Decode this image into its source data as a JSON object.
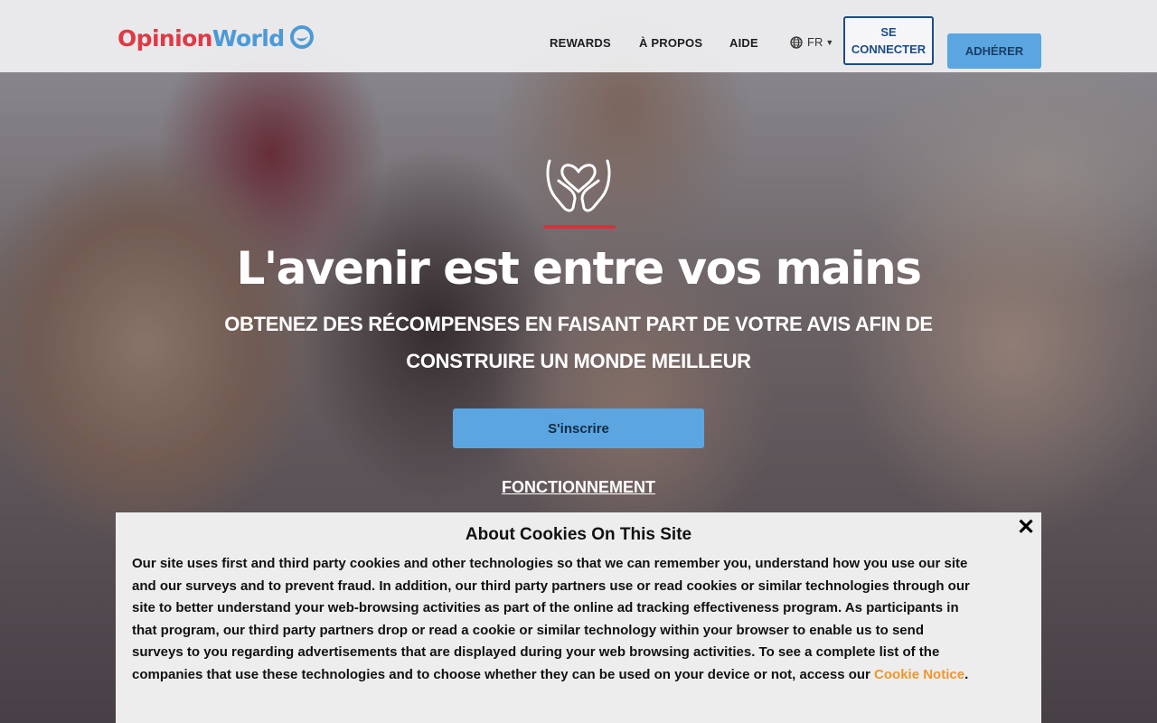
{
  "header": {
    "logo": {
      "part1": "Opinion",
      "part2": "World"
    },
    "nav": [
      {
        "label": "REWARDS"
      },
      {
        "label": "À PROPOS"
      },
      {
        "label": "AIDE"
      }
    ],
    "language": {
      "label": "FR",
      "icon": "globe-icon"
    },
    "login_label": "SE CONNECTER",
    "join_label": "ADHÉRER"
  },
  "hero": {
    "icon": "hands-heart-icon",
    "title": "L'avenir est entre vos mains",
    "subtitle": "OBTENEZ DES RÉCOMPENSES EN FAISANT PART DE VOTRE AVIS AFIN DE CONSTRUIRE UN MONDE MEILLEUR",
    "signup_label": "S'inscrire",
    "how_link": "FONCTIONNEMENT"
  },
  "cookie_banner": {
    "title": "About Cookies On This Site",
    "close_label": "✕",
    "text": "Our site uses first and third party cookies and other technologies so that we can remember you, understand how you use our site and our surveys and to prevent fraud. In addition, our third party partners use or read cookies or similar technologies through our site to better understand your web-browsing activities as part of the online ad tracking effectiveness program. As participants in that program, our third party partners drop or read a cookie or similar technology within your browser to enable us to send surveys to you regarding advertisements that are displayed during your web browsing activities. To see a complete list of the companies that use these technologies and to choose whether they can be used on your device or not, access our ",
    "link_label": "Cookie Notice",
    "text_end": "."
  },
  "colors": {
    "brand_red": "#e03a45",
    "brand_blue": "#4a9ad8",
    "button_blue": "#5ba6e0",
    "login_border": "#1b4d86",
    "cookie_link": "#f0962e"
  }
}
